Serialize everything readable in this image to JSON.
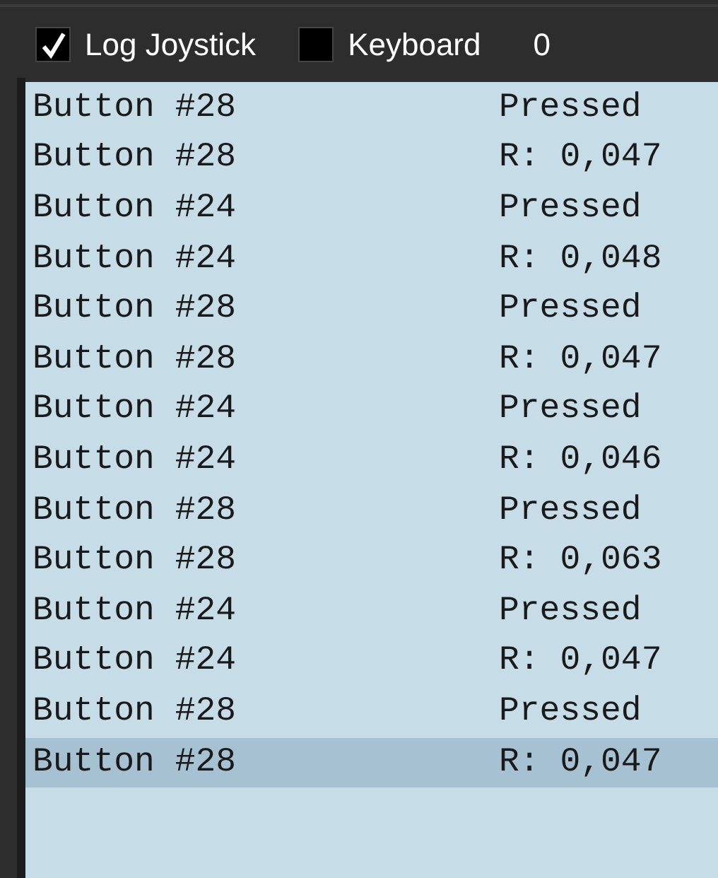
{
  "toolbar": {
    "checkboxes": [
      {
        "label": "Log Joystick",
        "checked": true
      },
      {
        "label": "Keyboard",
        "checked": false
      }
    ],
    "count": "0"
  },
  "log": {
    "rows": [
      {
        "source": "Button #28",
        "event": "Pressed",
        "selected": false
      },
      {
        "source": "Button #28",
        "event": "R: 0,047",
        "selected": false
      },
      {
        "source": "Button #24",
        "event": "Pressed",
        "selected": false
      },
      {
        "source": "Button #24",
        "event": "R: 0,048",
        "selected": false
      },
      {
        "source": "Button #28",
        "event": "Pressed",
        "selected": false
      },
      {
        "source": "Button #28",
        "event": "R: 0,047",
        "selected": false
      },
      {
        "source": "Button #24",
        "event": "Pressed",
        "selected": false
      },
      {
        "source": "Button #24",
        "event": "R: 0,046",
        "selected": false
      },
      {
        "source": "Button #28",
        "event": "Pressed",
        "selected": false
      },
      {
        "source": "Button #28",
        "event": "R: 0,063",
        "selected": false
      },
      {
        "source": "Button #24",
        "event": "Pressed",
        "selected": false
      },
      {
        "source": "Button #24",
        "event": "R: 0,047",
        "selected": false
      },
      {
        "source": "Button #28",
        "event": "Pressed",
        "selected": false
      },
      {
        "source": "Button #28",
        "event": "R: 0,047",
        "selected": true
      }
    ]
  }
}
